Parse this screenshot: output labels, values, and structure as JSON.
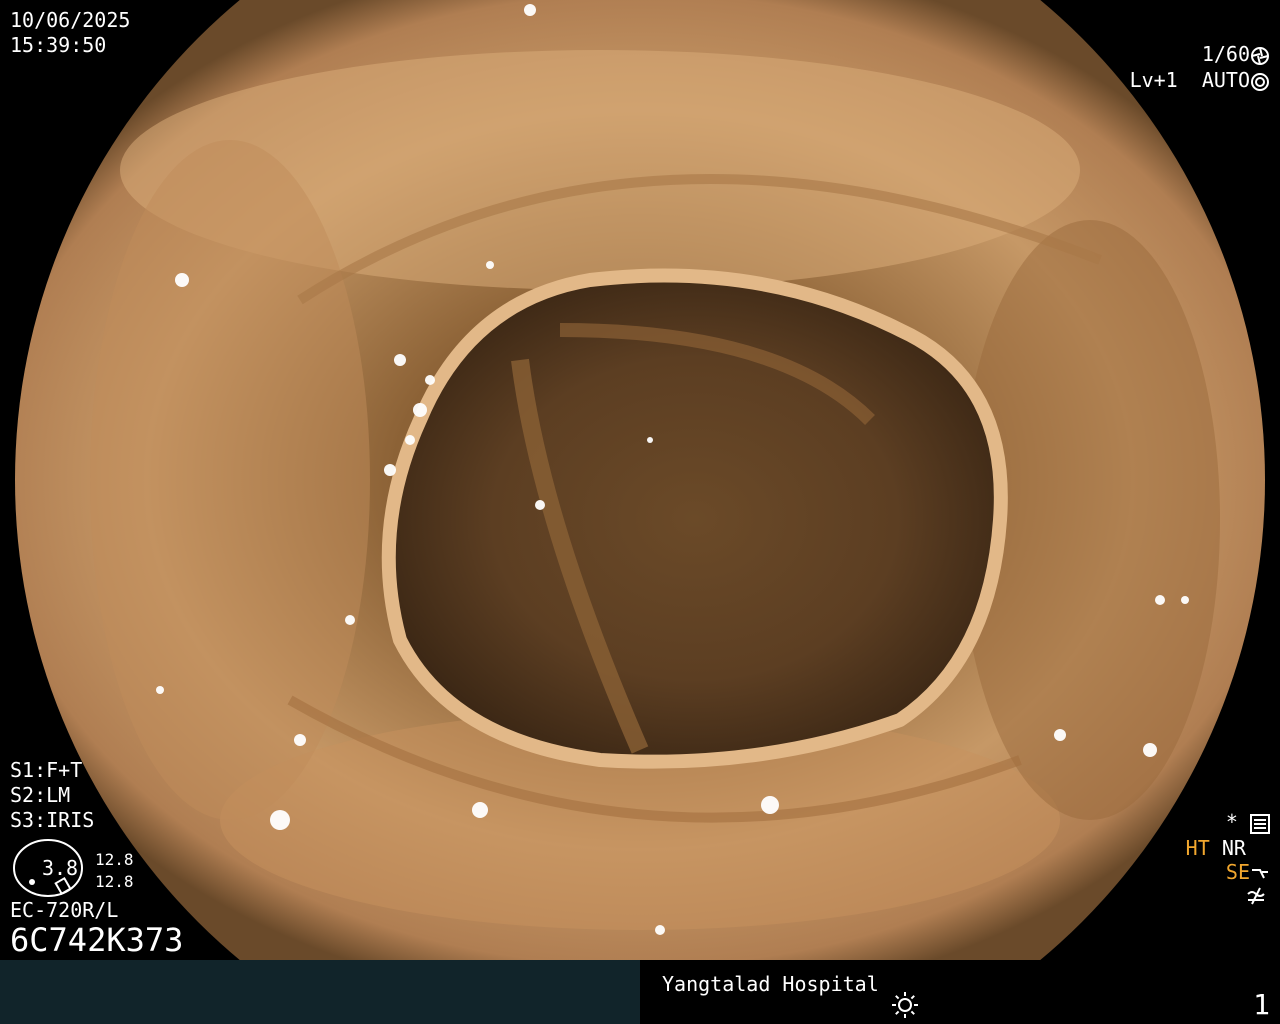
{
  "overlay": {
    "date": "10/06/2025",
    "time": "15:39:50",
    "shutter": "1/60",
    "level": "Lv+1",
    "auto": "AUTO",
    "s1": "S1:F+T",
    "s2": "S2:LM",
    "s3": "S3:IRIS",
    "gauge_value": "3.8",
    "readout_top": "12.8",
    "readout_bottom": "12.8",
    "model": "EC-720R/L",
    "serial": "6C742K373",
    "star": "*",
    "ht": "HT",
    "nr": "NR",
    "se": "SE"
  },
  "footer": {
    "hospital": "Yangtalad Hospital",
    "page": "1"
  },
  "colors": {
    "accent_orange": "#f2a72e",
    "footer_bg": "#11242a",
    "tissue": "#c89a6c"
  },
  "icons": [
    "shutter-icon",
    "auto-iris-icon",
    "settings-icon",
    "enhance-curve-icon",
    "brightness-sun-icon"
  ]
}
